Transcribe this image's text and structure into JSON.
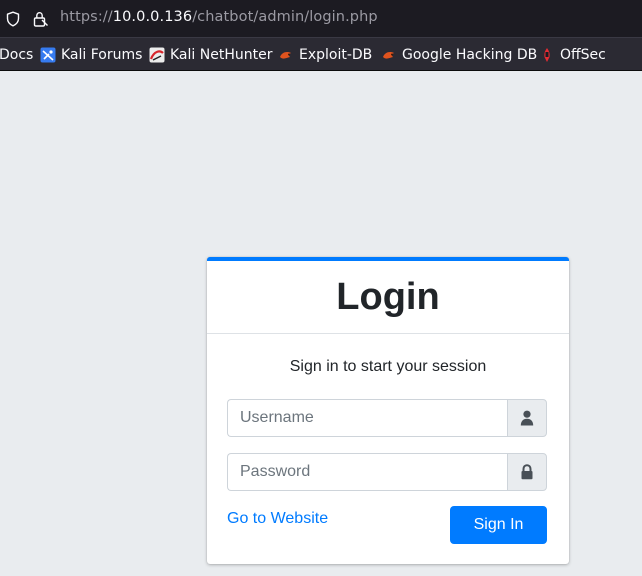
{
  "browser": {
    "url_scheme": "https://",
    "url_host": "10.0.0.136",
    "url_path": "/chatbot/admin/login.php"
  },
  "bookmarks": [
    {
      "label": "Docs",
      "icon": "none"
    },
    {
      "label": "Kali Forums",
      "icon": "kali-forums-icon"
    },
    {
      "label": "Kali NetHunter",
      "icon": "kali-nethunter-icon"
    },
    {
      "label": "Exploit-DB",
      "icon": "exploit-db-icon"
    },
    {
      "label": "Google Hacking DB",
      "icon": "exploit-db-icon"
    },
    {
      "label": "OffSec",
      "icon": "offsec-icon"
    }
  ],
  "colors": {
    "accent": "#007bff",
    "page_background": "#e9ecef",
    "toolbar": "#1c1b22",
    "bookmarks_bar": "#2b2a33"
  },
  "login": {
    "title": "Login",
    "message": "Sign in to start your session",
    "username_placeholder": "Username",
    "password_placeholder": "Password",
    "username_icon": "user-icon",
    "password_icon": "lock-icon",
    "website_link": "Go to Website",
    "signin_label": "Sign In"
  }
}
